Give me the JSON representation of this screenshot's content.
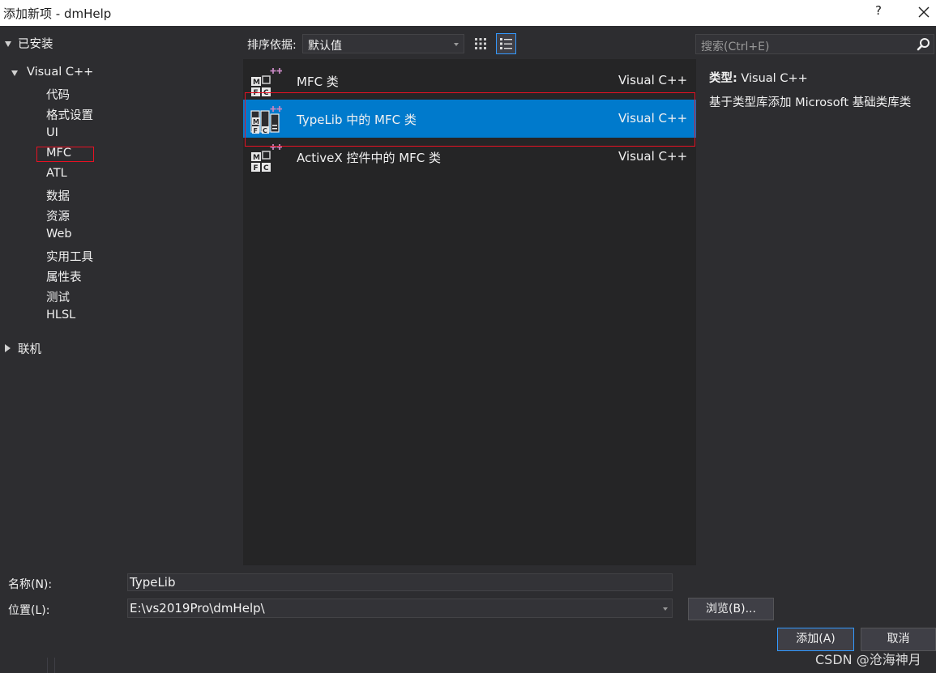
{
  "window": {
    "title": "添加新项 - dmHelp",
    "help_label": "?"
  },
  "tree": {
    "installed_label": "已安装",
    "visual_cpp_label": "Visual C++",
    "items": [
      {
        "label": "代码"
      },
      {
        "label": "格式设置"
      },
      {
        "label": "UI"
      },
      {
        "label": "MFC"
      },
      {
        "label": "ATL"
      },
      {
        "label": "数据"
      },
      {
        "label": "资源"
      },
      {
        "label": "Web"
      },
      {
        "label": "实用工具"
      },
      {
        "label": "属性表"
      },
      {
        "label": "测试"
      },
      {
        "label": "HLSL"
      }
    ],
    "online_label": "联机"
  },
  "toolbar": {
    "sort_label": "排序依据:",
    "sort_value": "默认值",
    "search_placeholder": "搜索(Ctrl+E)"
  },
  "templates": [
    {
      "name": "MFC 类",
      "language": "Visual C++",
      "selected": false
    },
    {
      "name": "TypeLib 中的 MFC 类",
      "language": "Visual C++",
      "selected": true
    },
    {
      "name": "ActiveX 控件中的 MFC 类",
      "language": "Visual C++",
      "selected": false
    }
  ],
  "info": {
    "type_label": "类型:",
    "type_value": "Visual C++",
    "description": "基于类型库添加 Microsoft 基础类库类"
  },
  "form": {
    "name_label": "名称(N):",
    "name_value": "TypeLib",
    "location_label": "位置(L):",
    "location_value": "E:\\vs2019Pro\\dmHelp\\",
    "browse_label": "浏览(B)...",
    "add_label": "添加(A)",
    "cancel_label": "取消"
  },
  "watermark": "CSDN @沧海神月",
  "colors": {
    "background": "#2d2d30",
    "list_background": "#252526",
    "selection": "#007acc",
    "annotation_red": "#e81123",
    "focus_border": "#3399ff"
  }
}
